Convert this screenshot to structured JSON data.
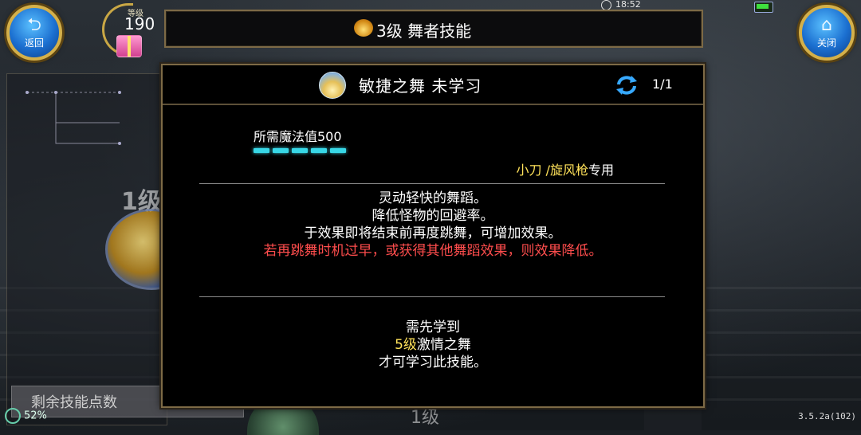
{
  "hud": {
    "back_label": "返回",
    "close_label": "关闭",
    "level_caption": "等级",
    "level_value": "190",
    "time": "18:52",
    "version": "3.5.2a(102)",
    "wifi_pct": "52%"
  },
  "title_bar": {
    "title": "3级  舞者技能"
  },
  "background": {
    "level_left": "1级",
    "skill_points_label": "剩余技能点数",
    "level_bottom": "1级"
  },
  "skill": {
    "name": "敏捷之舞  未学习",
    "page": "1/1",
    "mp_label": "所需魔法值500",
    "mp_segments": 5,
    "weapons": "小刀 /旋风枪",
    "weapons_suffix": "专用",
    "description": [
      "灵动轻快的舞蹈。",
      "降低怪物的回避率。",
      "于效果即将结束前再度跳舞，可增加效果。"
    ],
    "warning": "若再跳舞时机过早，或获得其他舞蹈效果，则效果降低。",
    "requirement_intro": "需先学到",
    "requirement_level": "5级",
    "requirement_skill": "激情之舞",
    "requirement_outro": "才可学习此技能。"
  },
  "colors": {
    "accent_gold": "#d4b04a",
    "mp_cyan": "#38d7e6",
    "warning_red": "#ff4d4d",
    "highlight_yellow": "#ffe25a"
  }
}
